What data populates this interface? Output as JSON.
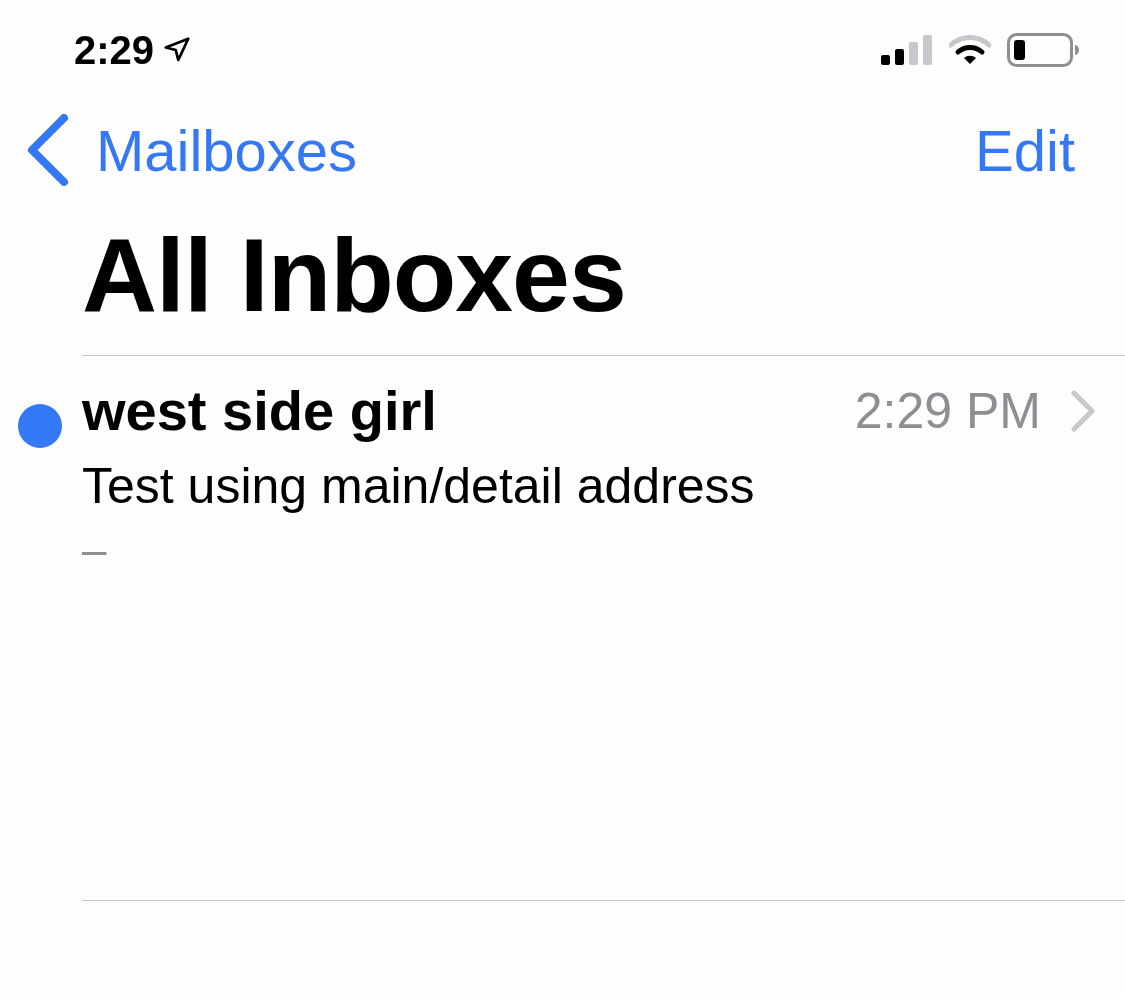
{
  "status_bar": {
    "time": "2:29"
  },
  "nav": {
    "back": "Mailboxes",
    "action": "Edit"
  },
  "title": "All Inboxes",
  "messages": [
    {
      "sender": "west side girl",
      "time": "2:29 PM",
      "subject": "Test using main/detail address",
      "preview": "–",
      "unread": true
    }
  ]
}
